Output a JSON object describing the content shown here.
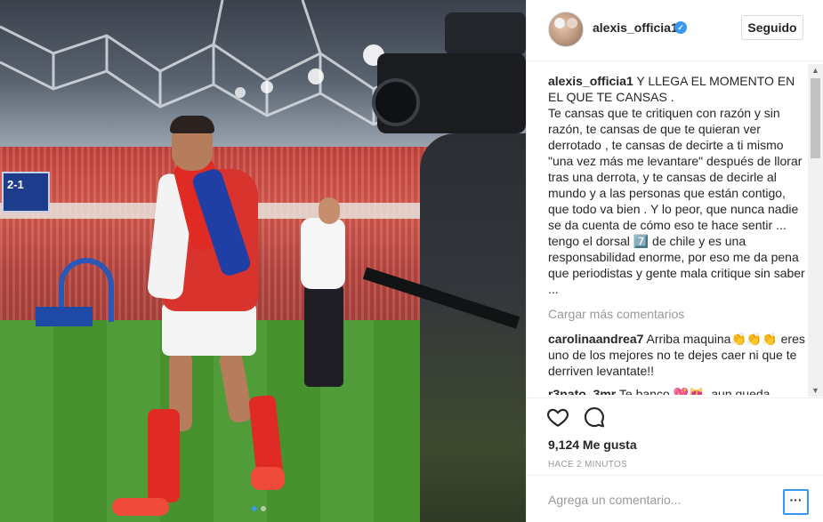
{
  "post": {
    "username": "alexis_officia1",
    "verified_icon": "verified-badge-icon",
    "follow_label": "Seguido",
    "caption_user": "alexis_officia1",
    "caption_text": " Y LLEGA EL MOMENTO EN EL QUE TE CANSAS .\nTe cansas que te critiquen con razón y sin razón, te cansas de que te quieran ver derrotado , te cansas de decirte a ti mismo \"una vez más me levantare\" después de llorar tras una derrota, y te cansas de decirle al mundo y a las personas que están contigo, que todo va bien . Y lo peor, que nunca nadie se da cuenta de cómo eso te hace sentir ... tengo el dorsal 7️⃣ de chile y es una responsabilidad enorme, por eso me da pena que periodistas y gente mala critique sin saber ...",
    "load_more": "Cargar más comentarios",
    "comments": [
      {
        "user": "carolinaandrea7",
        "text": " Arriba maquina👏👏👏 eres uno de los mejores no te dejes caer ni que te derriven levantate!!"
      },
      {
        "user": "r3nato_3mr",
        "text": " Te banco 💖😻, aun queda"
      }
    ],
    "likes": "9,124 Me gusta",
    "time": "HACE 2 MINUTOS",
    "comment_placeholder": "Agrega un comentario...",
    "more_label": "···",
    "scoreboard": "2-1",
    "carousel": {
      "count": 2,
      "active": 0
    }
  },
  "icons": {
    "like": "heart-icon",
    "comment": "comment-bubble-icon",
    "more": "more-options-icon"
  }
}
